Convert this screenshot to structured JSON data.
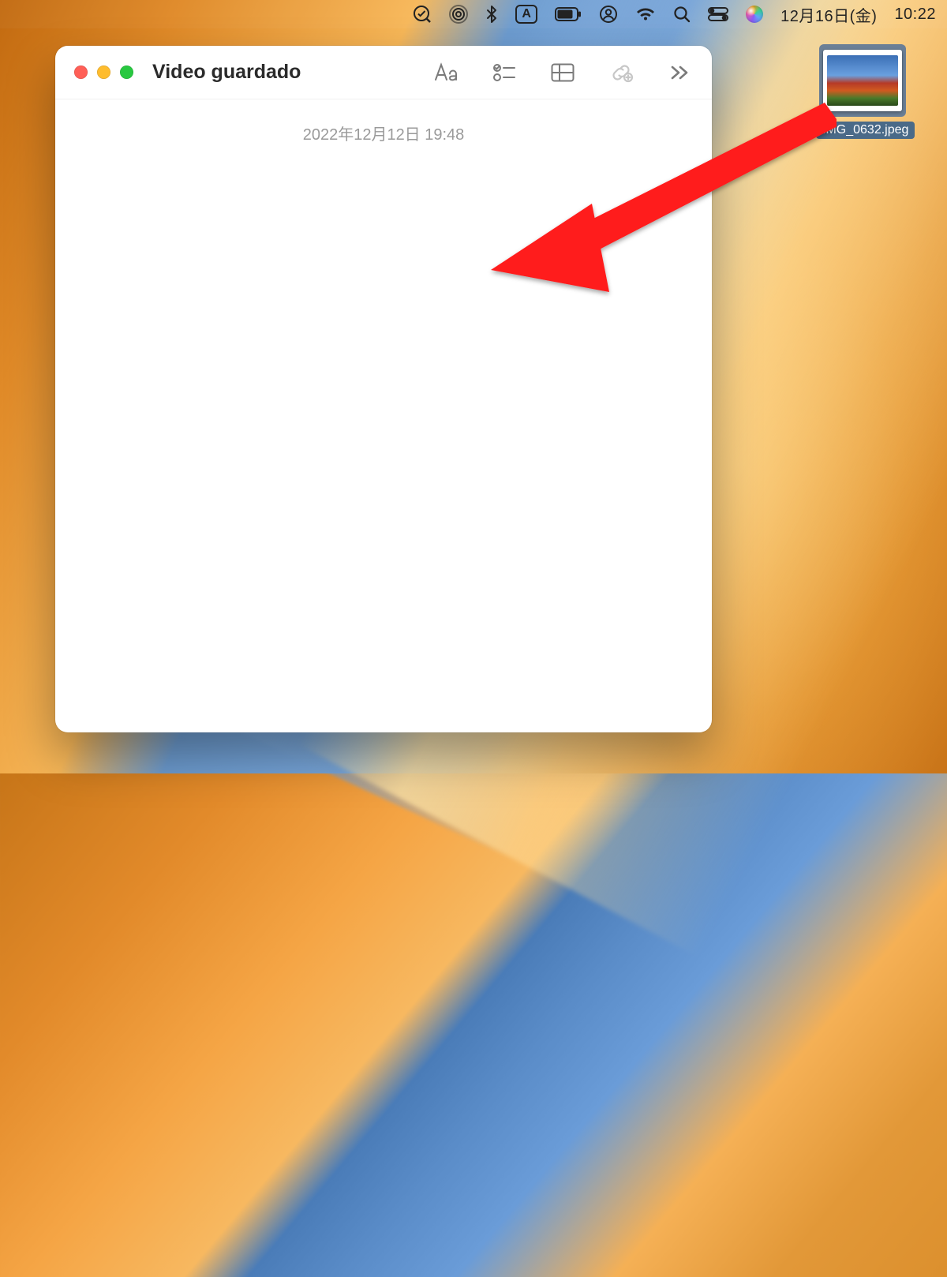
{
  "menubar": {
    "ime_letter": "A",
    "date": "12月16日(金)",
    "time": "10:22"
  },
  "desktop": {
    "file_label": "IMG_0632.jpeg"
  },
  "notes_window": {
    "title": "Video guardado",
    "timestamp": "2022年12月12日 19:48"
  }
}
